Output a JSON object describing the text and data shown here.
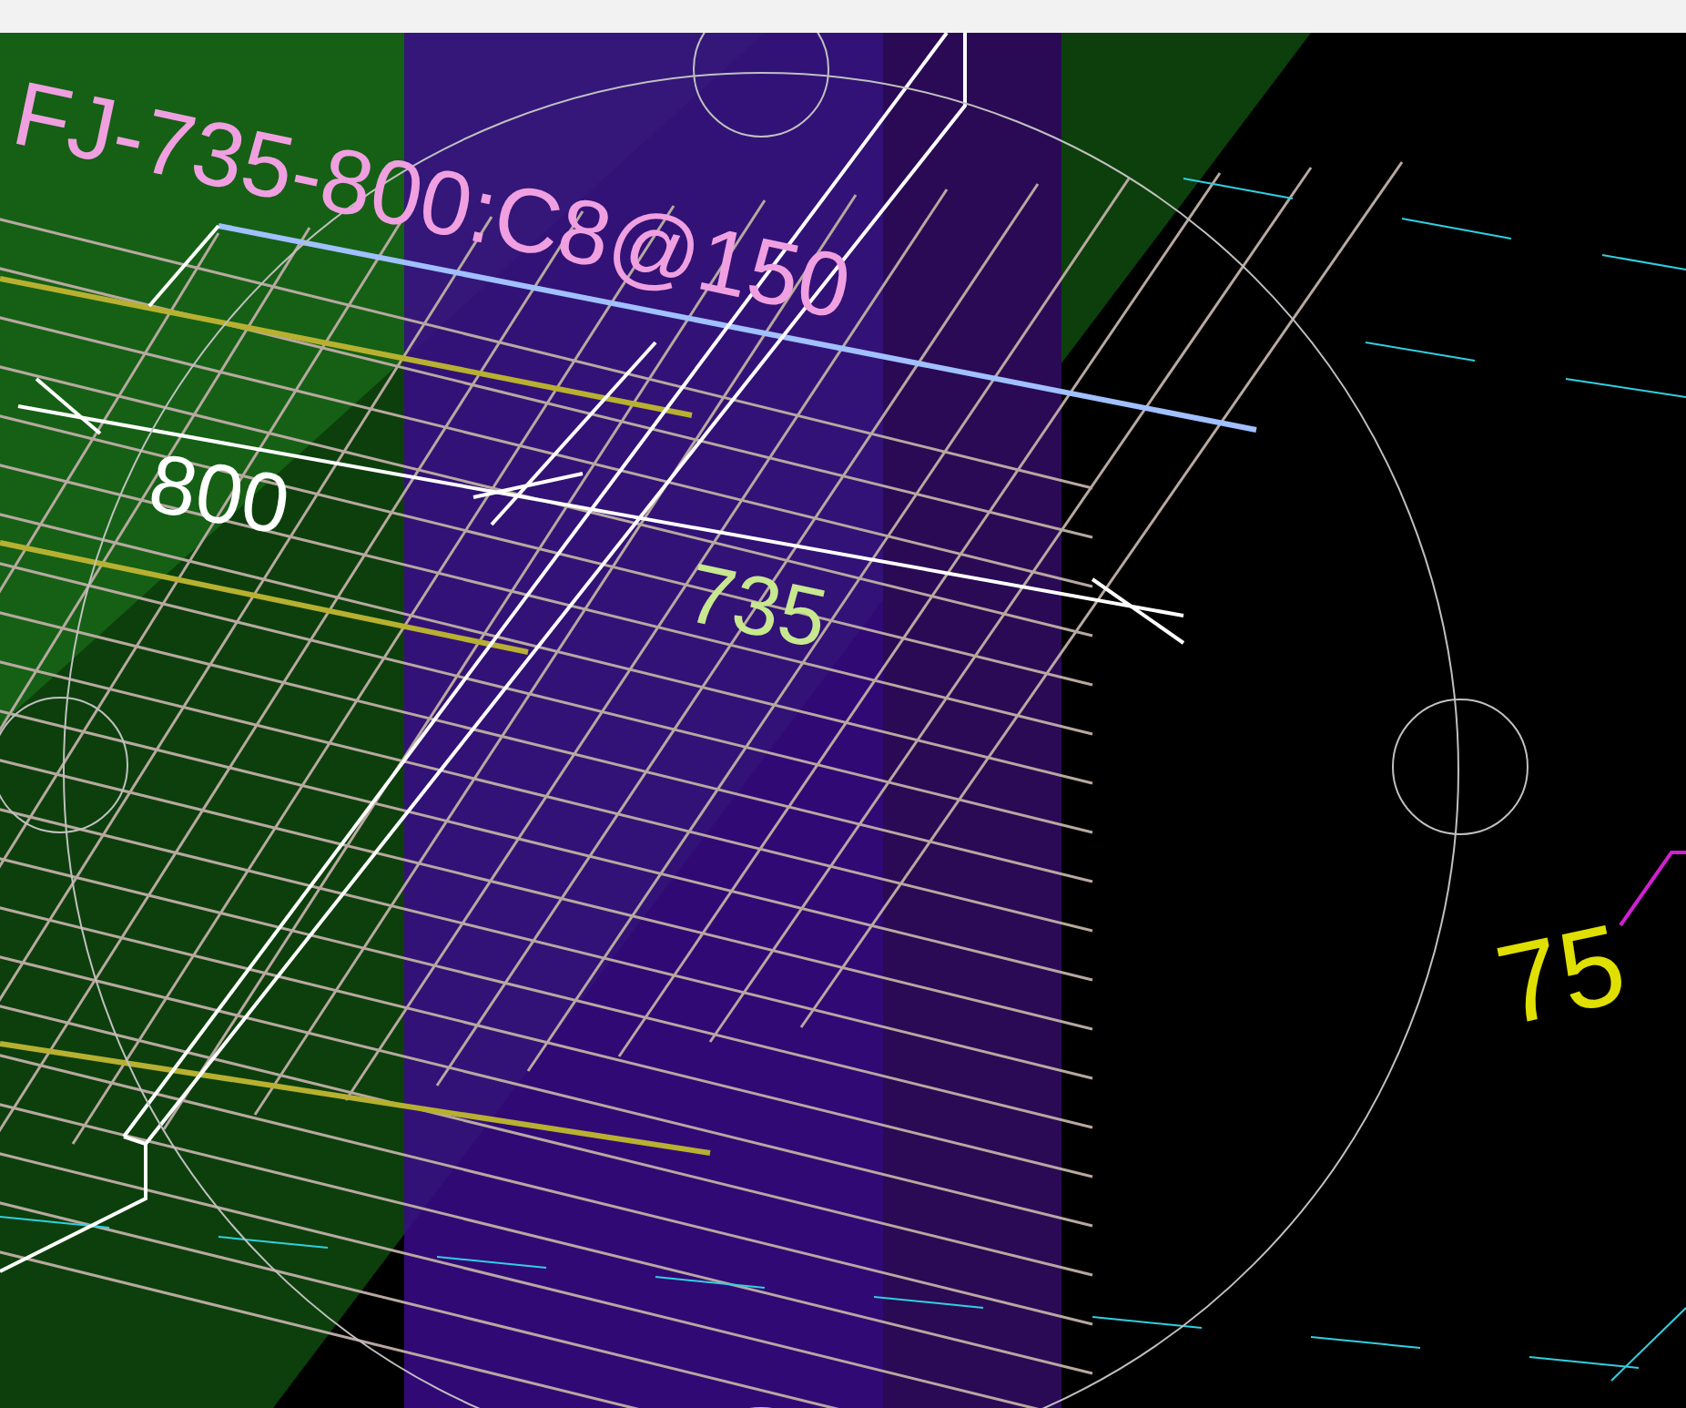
{
  "canvas": {
    "labels": [
      {
        "kind": "mark",
        "text": "FJ-735-800:C8@150",
        "color": "#f0a0e0"
      },
      {
        "kind": "dimension",
        "text": "800",
        "color": "#ffffff"
      },
      {
        "kind": "dimension",
        "text": "735",
        "color": "#c8e890"
      },
      {
        "kind": "elevation",
        "text": "75",
        "color": "#e0e000"
      }
    ]
  }
}
